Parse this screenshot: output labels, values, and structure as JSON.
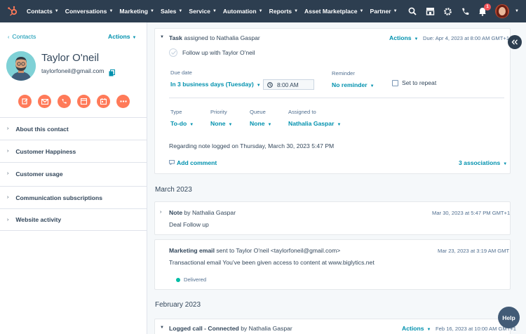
{
  "topnav": {
    "items": [
      {
        "label": "Contacts"
      },
      {
        "label": "Conversations"
      },
      {
        "label": "Marketing"
      },
      {
        "label": "Sales"
      },
      {
        "label": "Service"
      },
      {
        "label": "Automation"
      },
      {
        "label": "Reports"
      },
      {
        "label": "Asset Marketplace"
      },
      {
        "label": "Partner"
      }
    ],
    "notification_count": "1"
  },
  "sidebar": {
    "back_label": "Contacts",
    "actions_label": "Actions",
    "contact_name": "Taylor O'neil",
    "contact_email": "taylorfoneil@gmail.com",
    "sections": [
      {
        "label": "About this contact"
      },
      {
        "label": "Customer Happiness"
      },
      {
        "label": "Customer usage"
      },
      {
        "label": "Communication subscriptions"
      },
      {
        "label": "Website activity"
      }
    ]
  },
  "task": {
    "type_label": "Task",
    "assigned_text": "assigned to Nathalia Gaspar",
    "actions_label": "Actions",
    "due_text": "Due: Apr 4, 2023 at 8:00 AM GMT+1",
    "title": "Follow up with Taylor O'neil",
    "due_date_label": "Due date",
    "due_date_value": "In 3 business days (Tuesday)",
    "time_value": "8:00 AM",
    "reminder_label": "Reminder",
    "reminder_value": "No reminder",
    "repeat_label": "Set to repeat",
    "type_field_label": "Type",
    "type_value": "To-do",
    "priority_label": "Priority",
    "priority_value": "None",
    "queue_label": "Queue",
    "queue_value": "None",
    "assigned_label": "Assigned to",
    "assigned_value": "Nathalia Gaspar",
    "regarding_text": "Regarding note logged on Thursday, March 30, 2023 5:47 PM",
    "add_comment_label": "Add comment",
    "associations_label": "3 associations"
  },
  "feed": {
    "month_march": "March 2023",
    "note": {
      "type_label": "Note",
      "by_text": "by Nathalia Gaspar",
      "date": "Mar 30, 2023 at 5:47 PM GMT+1",
      "body": "Deal Follow up"
    },
    "email": {
      "type_label": "Marketing email",
      "sent_text": "sent to Taylor O'neil <taylorfoneil@gmail.com>",
      "date": "Mar 23, 2023 at 3:19 AM GMT",
      "body": "Transactional email You've been given access to content at www.biglytics.net",
      "status": "Delivered"
    },
    "month_february": "February 2023",
    "call": {
      "type_label": "Logged call - Connected",
      "by_text": "by Nathalia Gaspar",
      "actions_label": "Actions",
      "date": "Feb 16, 2023 at 10:00 AM GMT+1"
    }
  },
  "help_label": "Help",
  "colors": {
    "nav_bg": "#2d3e50",
    "accent_orange": "#ff7a59",
    "link_teal": "#0091ae",
    "delivered_green": "#00bda5"
  }
}
